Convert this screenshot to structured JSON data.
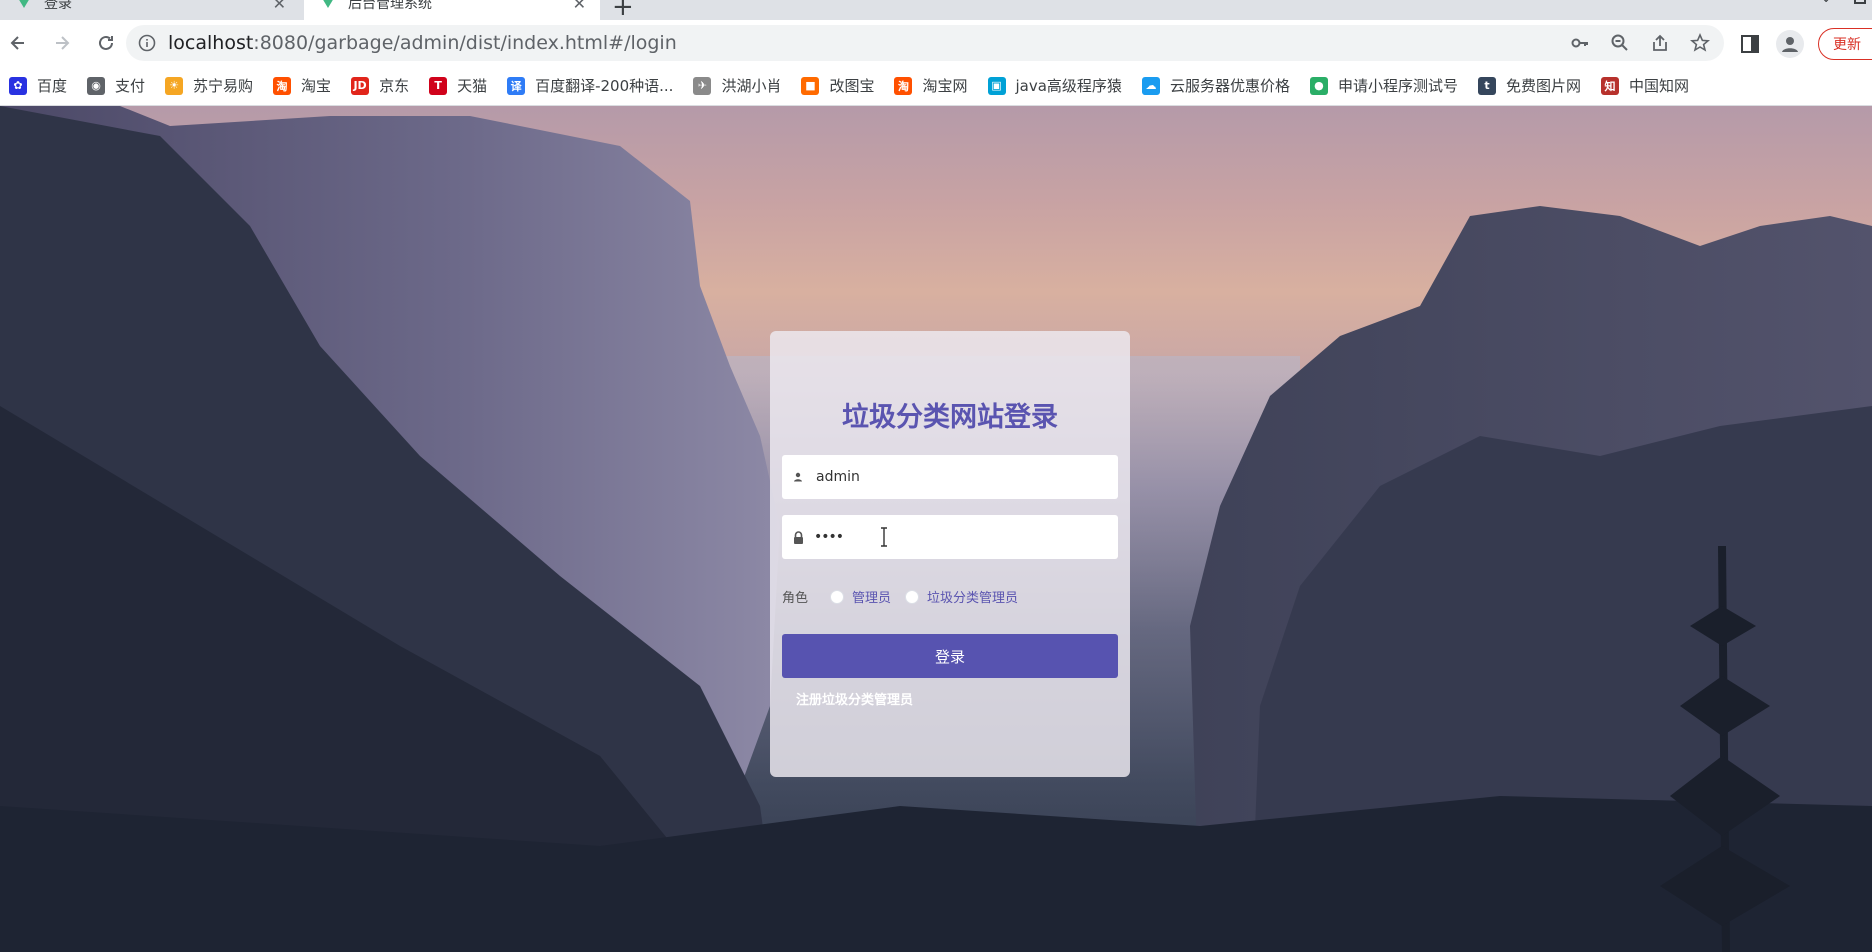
{
  "browser": {
    "tabs": [
      {
        "title": "登录",
        "active": false
      },
      {
        "title": "后台管理系统",
        "active": true
      }
    ],
    "address": {
      "host": "localhost",
      "rest": ":8080/garbage/admin/dist/index.html#/login"
    },
    "update_label": "更新",
    "bookmarks": [
      {
        "label": "百度",
        "icon": "paw-icon",
        "color": "#2932e1"
      },
      {
        "label": "支付",
        "icon": "globe-icon",
        "color": "#5f6368"
      },
      {
        "label": "苏宁易购",
        "icon": "lion-icon",
        "color": "#f5a623"
      },
      {
        "label": "淘宝",
        "icon": "taobao-icon",
        "color": "#ff5000"
      },
      {
        "label": "京东",
        "icon": "jd-icon",
        "color": "#e1251b"
      },
      {
        "label": "天猫",
        "icon": "tmall-icon",
        "color": "#d0021b"
      },
      {
        "label": "百度翻译-200种语...",
        "icon": "translate-icon",
        "color": "#2f7cf6"
      },
      {
        "label": "洪湖小肖",
        "icon": "bird-icon",
        "color": "#8a8a8a"
      },
      {
        "label": "改图宝",
        "icon": "image-tool-icon",
        "color": "#ff6a00"
      },
      {
        "label": "淘宝网",
        "icon": "taobao-icon",
        "color": "#ff5000"
      },
      {
        "label": "java高级程序猿",
        "icon": "tv-icon",
        "color": "#00a1d6"
      },
      {
        "label": "云服务器优惠价格",
        "icon": "cloud-icon",
        "color": "#1a9cf0"
      },
      {
        "label": "申请小程序测试号",
        "icon": "wechat-icon",
        "color": "#2aae67"
      },
      {
        "label": "免费图片网",
        "icon": "tumblr-icon",
        "color": "#35465c"
      },
      {
        "label": "中国知网",
        "icon": "cnki-icon",
        "color": "#b7312c"
      }
    ]
  },
  "login": {
    "title": "垃圾分类网站登录",
    "username": "admin",
    "password": "••••",
    "role_label": "角色",
    "roles": [
      "管理员",
      "垃圾分类管理员"
    ],
    "submit_label": "登录",
    "register_label": "注册垃圾分类管理员",
    "accent_color": "#5753b0"
  }
}
